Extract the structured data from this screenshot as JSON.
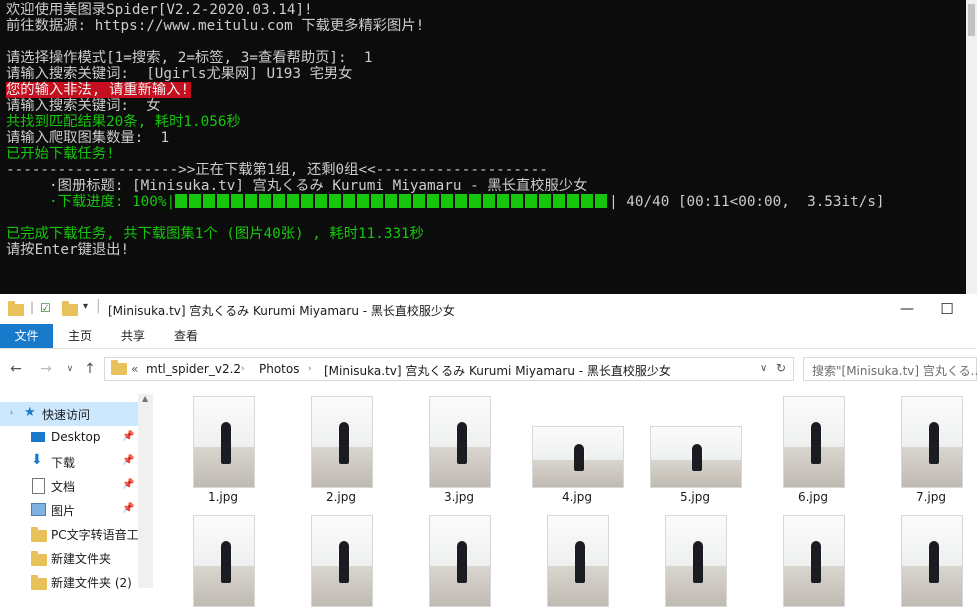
{
  "console": {
    "lines": [
      {
        "text": "欢迎使用美图录Spider[V2.2-2020.03.14]!",
        "style": "normal"
      },
      {
        "text": "前往数据源: https://www.meitulu.com 下载更多精彩图片!",
        "style": "normal"
      },
      {
        "text": "",
        "style": "normal"
      },
      {
        "text": "请选择操作模式[1=搜索, 2=标签, 3=查看帮助页]:  1",
        "style": "normal"
      },
      {
        "text": "请输入搜索关键词:  [Ugirls尤果网] U193 宅男女",
        "style": "normal"
      },
      {
        "text": "您的输入非法, 请重新输入!",
        "style": "error"
      },
      {
        "text": "请输入搜索关键词:  女",
        "style": "normal"
      },
      {
        "text": "共找到匹配结果20条, 耗时1.056秒",
        "style": "green"
      },
      {
        "text": "请输入爬取图集数量:  1",
        "style": "normal"
      },
      {
        "text": "已开始下载任务!",
        "style": "green"
      },
      {
        "text": "-------------------->>正在下载第1组, 还剩0组<<--------------------",
        "style": "normal"
      },
      {
        "text": "     ·图册标题: [Minisuka.tv] 宫丸くるみ Kurumi Miyamaru - 黑长直校服少女",
        "style": "normal"
      },
      {
        "text": "",
        "style": "normal"
      },
      {
        "text": "",
        "style": "normal"
      },
      {
        "text": "已完成下载任务, 共下载图集1个 (图片40张) , 耗时11.331秒",
        "style": "green"
      },
      {
        "text": "请按Enter键退出!",
        "style": "normal"
      }
    ],
    "progress": {
      "label": "     ·下载进度: 100%|",
      "fraction": 1.0,
      "stats": "| 40/40 [00:11<00:00,  3.53it/s]"
    }
  },
  "explorer": {
    "title": "[Minisuka.tv] 宫丸くるみ Kurumi Miyamaru - 黑长直校服少女",
    "window_buttons": {
      "minimize": "—",
      "maximize": "☐"
    },
    "ribbon_tabs": [
      "文件",
      "主页",
      "共享",
      "查看"
    ],
    "breadcrumb": [
      "mtl_spider_v2.2",
      "Photos",
      "[Minisuka.tv] 宫丸くるみ Kurumi Miyamaru - 黑长直校服少女"
    ],
    "breadcrumb_prefix": "«",
    "search_placeholder": "搜索\"[Minisuka.tv] 宫丸くる...",
    "nav_items": [
      {
        "label": "快速访问",
        "icon": "star-icon",
        "pinned": false,
        "selected": true
      },
      {
        "label": "Desktop",
        "icon": "desktop-icon",
        "pinned": true,
        "selected": false
      },
      {
        "label": "下载",
        "icon": "download-icon",
        "pinned": true,
        "selected": false
      },
      {
        "label": "文档",
        "icon": "document-icon",
        "pinned": true,
        "selected": false
      },
      {
        "label": "图片",
        "icon": "picture-icon",
        "pinned": true,
        "selected": false
      },
      {
        "label": "PC文字转语音工",
        "icon": "folder-icon",
        "pinned": false,
        "selected": false
      },
      {
        "label": "新建文件夹",
        "icon": "folder-icon",
        "pinned": false,
        "selected": false
      },
      {
        "label": "新建文件夹 (2)",
        "icon": "folder-icon",
        "pinned": false,
        "selected": false
      }
    ],
    "files": [
      {
        "name": "1.jpg",
        "orientation": "portrait"
      },
      {
        "name": "2.jpg",
        "orientation": "portrait"
      },
      {
        "name": "3.jpg",
        "orientation": "portrait"
      },
      {
        "name": "4.jpg",
        "orientation": "landscape"
      },
      {
        "name": "5.jpg",
        "orientation": "landscape"
      },
      {
        "name": "6.jpg",
        "orientation": "portrait"
      },
      {
        "name": "7.jpg",
        "orientation": "portrait"
      }
    ],
    "files_row2": [
      {
        "orientation": "portrait"
      },
      {
        "orientation": "portrait"
      },
      {
        "orientation": "portrait"
      },
      {
        "orientation": "portrait"
      },
      {
        "orientation": "portrait"
      },
      {
        "orientation": "portrait"
      },
      {
        "orientation": "portrait"
      }
    ],
    "accent_color": "#1979ca",
    "selected_nav_color": "#cce8ff"
  }
}
